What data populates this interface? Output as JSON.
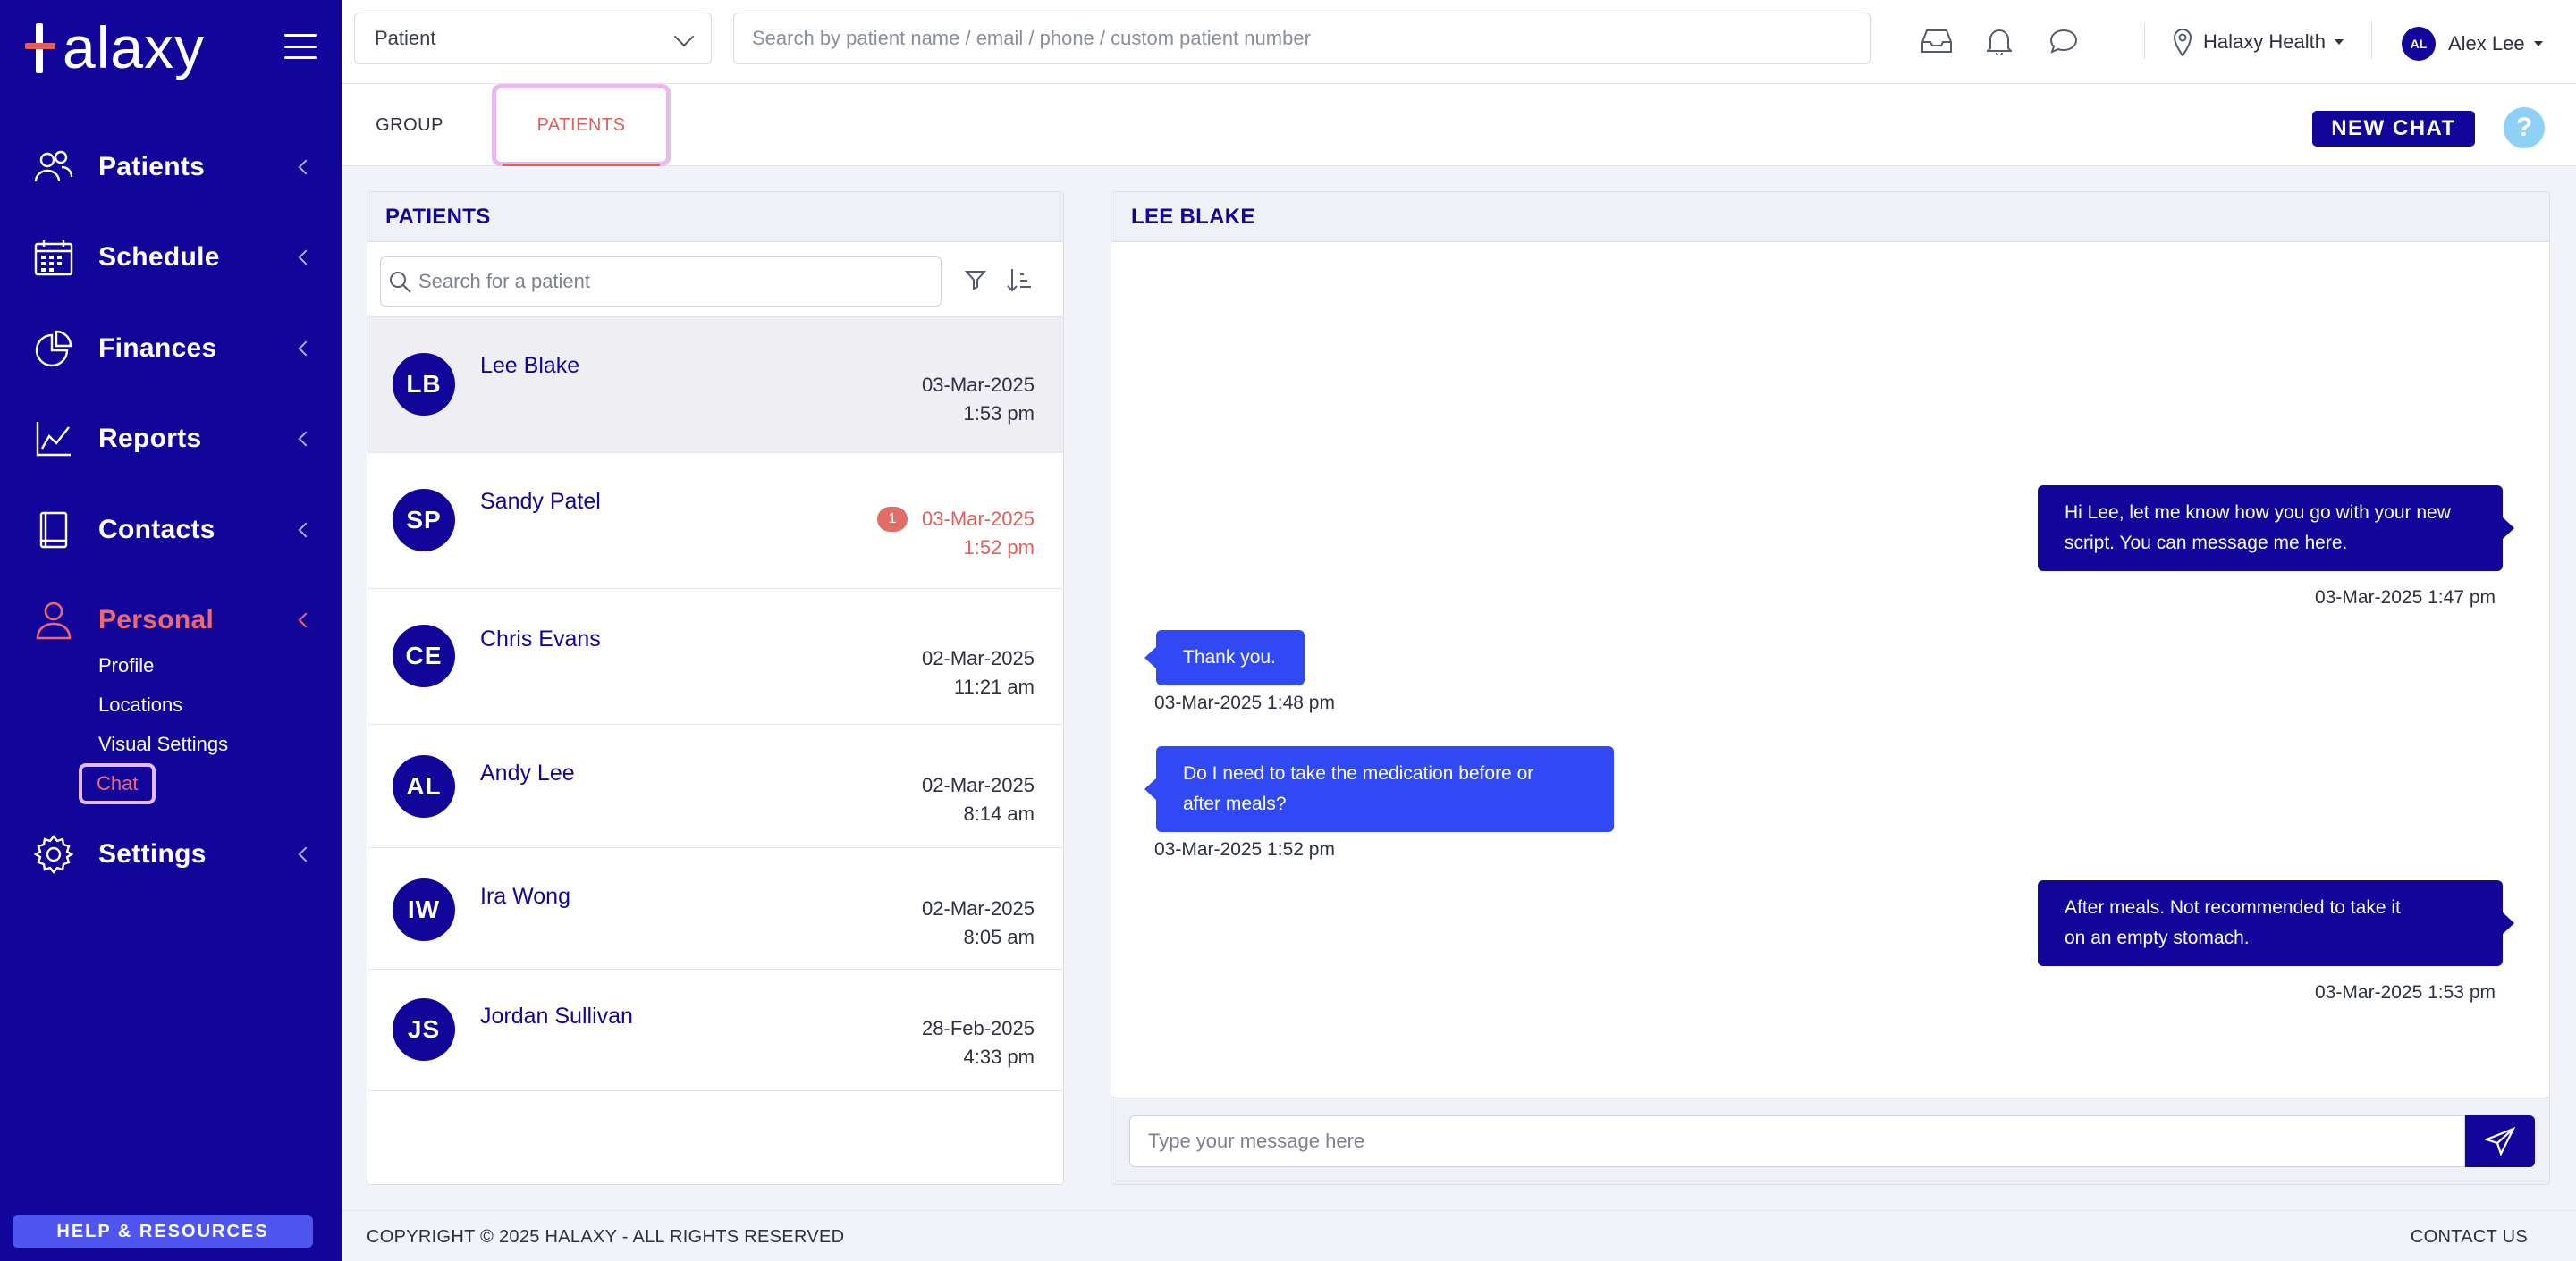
{
  "brand": {
    "logo_text": "alaxy"
  },
  "sidebar": {
    "nav": [
      {
        "label": "Patients",
        "icon": "users-icon"
      },
      {
        "label": "Schedule",
        "icon": "calendar-icon"
      },
      {
        "label": "Finances",
        "icon": "pie-chart-icon"
      },
      {
        "label": "Reports",
        "icon": "line-chart-icon"
      },
      {
        "label": "Contacts",
        "icon": "address-book-icon"
      },
      {
        "label": "Personal",
        "icon": "user-icon",
        "active": true
      },
      {
        "label": "Settings",
        "icon": "gear-icon"
      }
    ],
    "personal_sub": [
      {
        "label": "Profile"
      },
      {
        "label": "Locations"
      },
      {
        "label": "Visual Settings"
      },
      {
        "label": "Chat",
        "active": true
      }
    ],
    "help_label": "HELP & RESOURCES"
  },
  "topbar": {
    "patient_select": "Patient",
    "search_placeholder": "Search by patient name / email / phone / custom patient number",
    "location": "Halaxy Health",
    "user_initials": "AL",
    "user_name": "Alex Lee"
  },
  "tabs": {
    "group": "GROUP",
    "patients": "PATIENTS",
    "new_chat": "NEW CHAT",
    "help": "?"
  },
  "patients_panel": {
    "title": "PATIENTS",
    "search_placeholder": "Search for a patient",
    "rows": [
      {
        "initials": "LB",
        "name": "Lee Blake",
        "date": "03-Mar-2025",
        "time": "1:53 pm",
        "selected": true
      },
      {
        "initials": "SP",
        "name": "Sandy Patel",
        "date": "03-Mar-2025",
        "time": "1:52 pm",
        "unread": "1"
      },
      {
        "initials": "CE",
        "name": "Chris Evans",
        "date": "02-Mar-2025",
        "time": "11:21 am"
      },
      {
        "initials": "AL",
        "name": "Andy Lee",
        "date": "02-Mar-2025",
        "time": "8:14 am"
      },
      {
        "initials": "IW",
        "name": "Ira Wong",
        "date": "02-Mar-2025",
        "time": "8:05 am"
      },
      {
        "initials": "JS",
        "name": "Jordan Sullivan",
        "date": "28-Feb-2025",
        "time": "4:33 pm"
      }
    ]
  },
  "chat": {
    "title": "LEE BLAKE",
    "messages": [
      {
        "dir": "out",
        "line1": "Hi Lee, let me know how you go with your new",
        "line2": "script. You can message me here.",
        "time": "03-Mar-2025 1:47 pm"
      },
      {
        "dir": "in",
        "line1": "Thank you.",
        "time": "03-Mar-2025 1:48 pm"
      },
      {
        "dir": "in",
        "line1": "Do I need to take the medication before or",
        "line2": "after meals?",
        "time": "03-Mar-2025 1:52 pm"
      },
      {
        "dir": "out",
        "line1": "After meals. Not recommended to take it",
        "line2": "on an empty stomach.",
        "time": "03-Mar-2025 1:53 pm"
      }
    ],
    "input_placeholder": "Type your message here"
  },
  "footer": {
    "copyright": "COPYRIGHT © 2025 HALAXY - ALL RIGHTS RESERVED",
    "contact": "CONTACT US"
  },
  "colors": {
    "primary": "#12069a",
    "accent": "#e55f5a",
    "incoming_bubble": "#3149f5",
    "highlight_frame": "#e9b8ee"
  }
}
